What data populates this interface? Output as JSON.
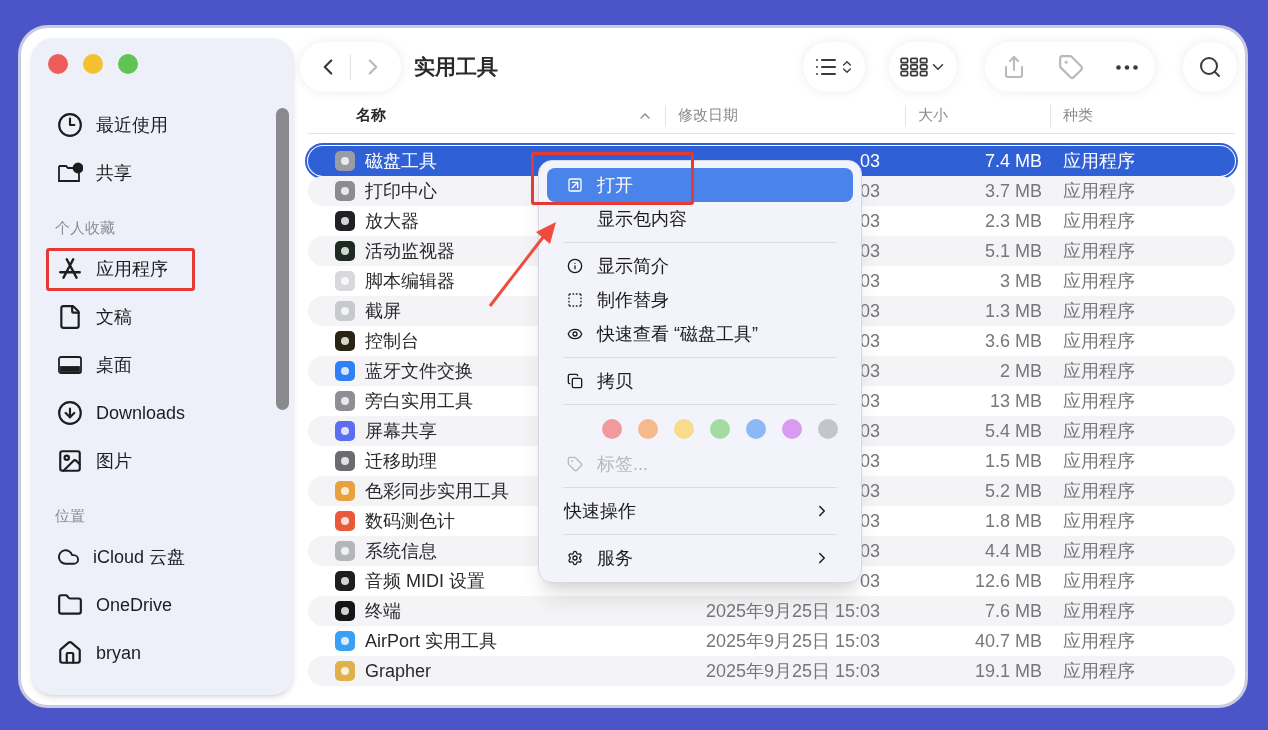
{
  "sidebar": {
    "sections": [
      {
        "items": [
          {
            "label": "最近使用",
            "selected": false
          },
          {
            "label": "共享",
            "selected": false
          }
        ]
      },
      {
        "title": "个人收藏",
        "items": [
          {
            "label": "应用程序",
            "selected": false
          },
          {
            "label": "文稿",
            "selected": false
          },
          {
            "label": "桌面",
            "selected": false
          },
          {
            "label": "Downloads",
            "selected": false
          },
          {
            "label": "图片",
            "selected": false
          }
        ]
      },
      {
        "title": "位置",
        "items": [
          {
            "label": "iCloud 云盘",
            "selected": false
          },
          {
            "label": "OneDrive",
            "selected": false
          },
          {
            "label": "bryan",
            "selected": false
          }
        ]
      }
    ]
  },
  "toolbar": {
    "title": "实用工具",
    "buttons": [
      {
        "disabled": false
      },
      {
        "disabled": true
      },
      {
        "disabled": false
      },
      {
        "disabled": false
      },
      {
        "disabled": true
      },
      {
        "disabled": true
      },
      {
        "disabled": false
      },
      {
        "disabled": false
      }
    ]
  },
  "table": {
    "columns": [
      {
        "label": "名称",
        "sorted": true
      },
      {
        "label": "修改日期",
        "sorted": false
      },
      {
        "label": "大小",
        "sorted": false
      },
      {
        "label": "种类",
        "sorted": false
      }
    ],
    "rows": [
      {
        "name": "磁盘工具",
        "date": "03",
        "size": "7.4 MB",
        "file_type": "应用程序",
        "selected": true
      },
      {
        "name": "打印中心",
        "date": "03",
        "size": "3.7 MB",
        "file_type": "应用程序",
        "selected": false
      },
      {
        "name": "放大器",
        "date": "03",
        "size": "2.3 MB",
        "file_type": "应用程序",
        "selected": false
      },
      {
        "name": "活动监视器",
        "date": "03",
        "size": "5.1 MB",
        "file_type": "应用程序",
        "selected": false
      },
      {
        "name": "脚本编辑器",
        "date": "03",
        "size": "3 MB",
        "file_type": "应用程序",
        "selected": false
      },
      {
        "name": "截屏",
        "date": "03",
        "size": "1.3 MB",
        "file_type": "应用程序",
        "selected": false
      },
      {
        "name": "控制台",
        "date": "03",
        "size": "3.6 MB",
        "file_type": "应用程序",
        "selected": false
      },
      {
        "name": "蓝牙文件交换",
        "date": "03",
        "size": "2 MB",
        "file_type": "应用程序",
        "selected": false
      },
      {
        "name": "旁白实用工具",
        "date": "03",
        "size": "13 MB",
        "file_type": "应用程序",
        "selected": false
      },
      {
        "name": "屏幕共享",
        "date": "03",
        "size": "5.4 MB",
        "file_type": "应用程序",
        "selected": false
      },
      {
        "name": "迁移助理",
        "date": "03",
        "size": "1.5 MB",
        "file_type": "应用程序",
        "selected": false
      },
      {
        "name": "色彩同步实用工具",
        "date": "03",
        "size": "5.2 MB",
        "file_type": "应用程序",
        "selected": false
      },
      {
        "name": "数码测色计",
        "date": "03",
        "size": "1.8 MB",
        "file_type": "应用程序",
        "selected": false
      },
      {
        "name": "系统信息",
        "date": "03",
        "size": "4.4 MB",
        "file_type": "应用程序",
        "selected": false
      },
      {
        "name": "音频 MIDI 设置",
        "date": "03",
        "size": "12.6 MB",
        "file_type": "应用程序",
        "selected": false
      },
      {
        "name": "终端",
        "date": "2025年9月25日 15:03",
        "size": "7.6 MB",
        "file_type": "应用程序",
        "selected": false
      },
      {
        "name": "AirPort 实用工具",
        "date": "2025年9月25日 15:03",
        "size": "40.7 MB",
        "file_type": "应用程序",
        "selected": false
      },
      {
        "name": "Grapher",
        "date": "2025年9月25日 15:03",
        "size": "19.1 MB",
        "file_type": "应用程序",
        "selected": false
      }
    ]
  },
  "context_menu": {
    "items": [
      {
        "kind": "item",
        "label": "打开",
        "selected": true,
        "disabled": false
      },
      {
        "kind": "item",
        "label": "显示包内容",
        "selected": false,
        "disabled": false
      },
      {
        "kind": "separator"
      },
      {
        "kind": "item",
        "label": "显示简介",
        "selected": false,
        "disabled": false
      },
      {
        "kind": "item",
        "label": "制作替身",
        "selected": false,
        "disabled": false
      },
      {
        "kind": "item",
        "label": "快速查看 “磁盘工具”",
        "selected": false,
        "disabled": false
      },
      {
        "kind": "separator"
      },
      {
        "kind": "item",
        "label": "拷贝",
        "selected": false,
        "disabled": false
      },
      {
        "kind": "separator"
      },
      {
        "kind": "colors",
        "colors": [
          {
            "color": "#f19a9c"
          },
          {
            "color": "#f5b98c"
          },
          {
            "color": "#f7dc8c"
          },
          {
            "color": "#a3dba0"
          },
          {
            "color": "#8cb9f5"
          },
          {
            "color": "#d79cf0"
          },
          {
            "color": "#c4c5ca"
          }
        ]
      },
      {
        "kind": "item",
        "label": "标签...",
        "selected": false,
        "disabled": true
      },
      {
        "kind": "separator"
      },
      {
        "kind": "submenu",
        "label": "快速操作",
        "selected": false
      },
      {
        "kind": "separator"
      },
      {
        "kind": "submenu",
        "label": "服务",
        "selected": false
      }
    ]
  }
}
